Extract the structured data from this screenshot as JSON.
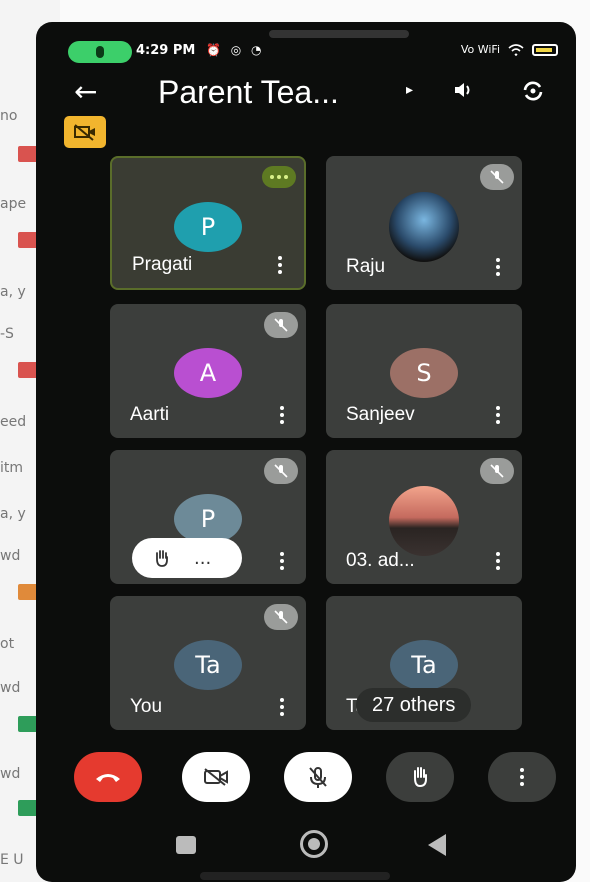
{
  "status_bar": {
    "time": "4:29 PM",
    "network": "Vo WiFi"
  },
  "header": {
    "title": "Parent Tea...",
    "caret": "▸",
    "back_glyph": "←"
  },
  "tiles": [
    {
      "name": "Pragati",
      "initial": "P",
      "avatar_color": "#1f9fae",
      "talking": true
    },
    {
      "name": "Raju",
      "photo": true
    },
    {
      "name": "Aarti",
      "initial": "A",
      "avatar_color": "#b94fd1"
    },
    {
      "name": "Sanjeev",
      "initial": "S",
      "avatar_color": "#9c7066"
    },
    {
      "name": "",
      "initial": "P",
      "avatar_color": "#6d8a98",
      "raised_hand": true,
      "hand_more": "..."
    },
    {
      "name": "03. ad...",
      "photo": true
    },
    {
      "name": "You",
      "initial": "Ta",
      "avatar_color": "#4a6578"
    },
    {
      "name": "Ta",
      "initial": "Ta",
      "avatar_color": "#4a6578",
      "others_label": "27 others"
    }
  ],
  "background_list": {
    "snippets": [
      "no",
      "ape",
      "a, y",
      "-S",
      "eed",
      "itm",
      "a, y",
      "wd",
      "ot",
      "wd",
      "wd",
      "E U"
    ]
  },
  "colors": {
    "end_call": "#e53a2f",
    "active_speaker_border": "#5a6d2a",
    "cam_off_badge": "#f2b52e"
  },
  "controls": [
    "end-call",
    "camera-off",
    "mic-off",
    "raise-hand",
    "more-options"
  ],
  "nav": [
    "recents",
    "home",
    "back"
  ]
}
